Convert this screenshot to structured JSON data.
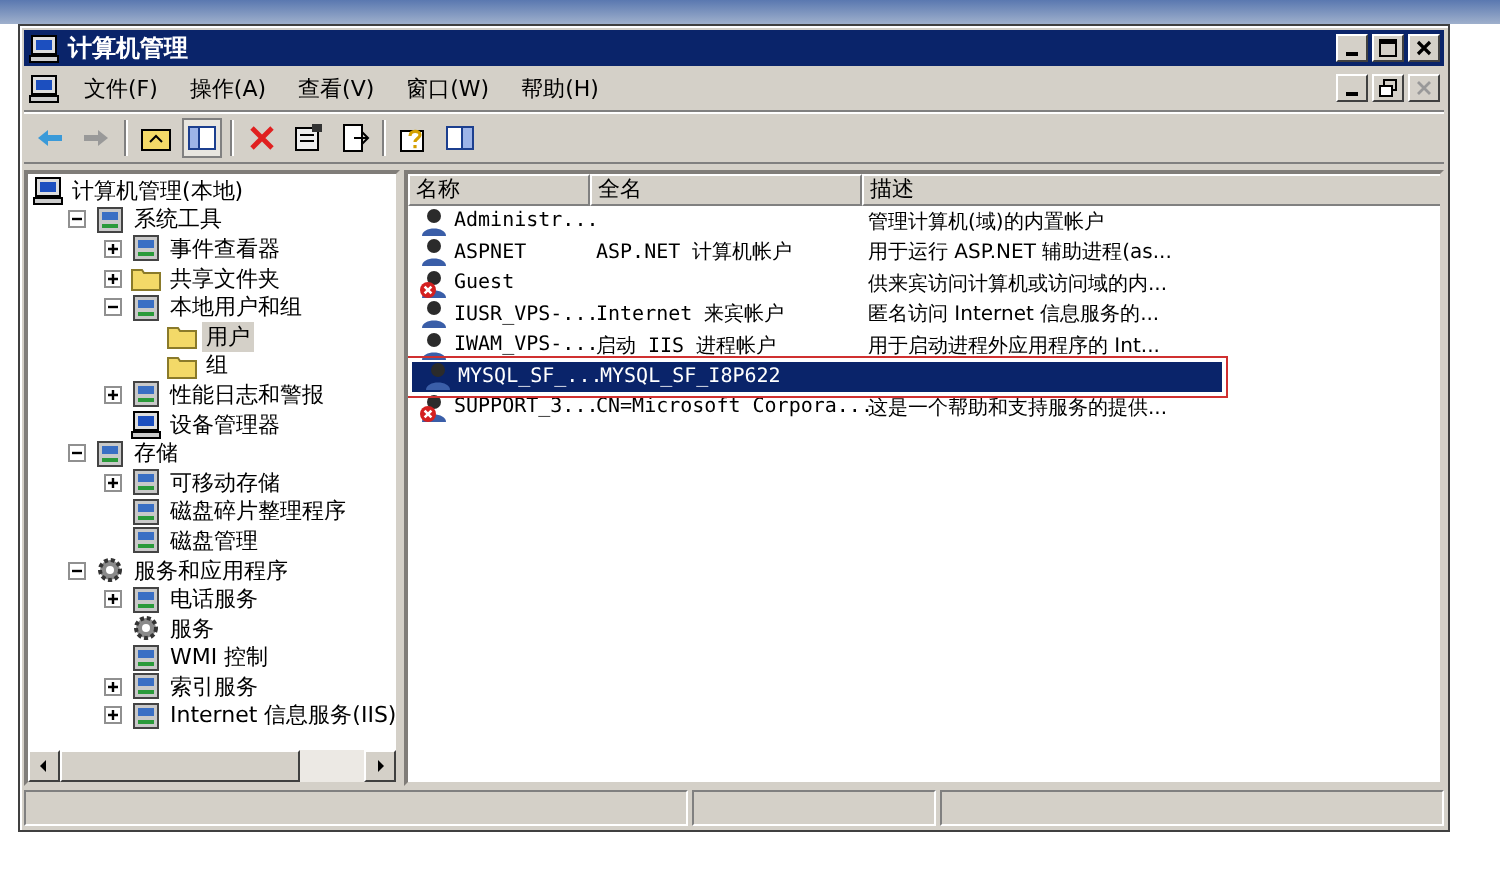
{
  "window": {
    "title": "计算机管理"
  },
  "menu": [
    "文件(F)",
    "操作(A)",
    "查看(V)",
    "窗口(W)",
    "帮助(H)"
  ],
  "tree": {
    "label": "计算机管理(本地)",
    "kind": "computer",
    "selected": false,
    "children": [
      {
        "label": "系统工具",
        "kind": "item",
        "expanded": true,
        "selected": false,
        "children": [
          {
            "label": "事件查看器",
            "kind": "item",
            "expanded": false,
            "selected": false
          },
          {
            "label": "共享文件夹",
            "kind": "folder",
            "expanded": false,
            "selected": false
          },
          {
            "label": "本地用户和组",
            "kind": "item",
            "expanded": true,
            "selected": false,
            "children": [
              {
                "label": "用户",
                "kind": "folder",
                "selected": true
              },
              {
                "label": "组",
                "kind": "folder",
                "selected": false
              }
            ]
          },
          {
            "label": "性能日志和警报",
            "kind": "item",
            "expanded": false,
            "selected": false
          },
          {
            "label": "设备管理器",
            "kind": "computer",
            "selected": false
          }
        ]
      },
      {
        "label": "存储",
        "kind": "item",
        "expanded": true,
        "selected": false,
        "children": [
          {
            "label": "可移动存储",
            "kind": "item",
            "expanded": false,
            "selected": false
          },
          {
            "label": "磁盘碎片整理程序",
            "kind": "item",
            "selected": false
          },
          {
            "label": "磁盘管理",
            "kind": "item",
            "selected": false
          }
        ]
      },
      {
        "label": "服务和应用程序",
        "kind": "gear",
        "expanded": true,
        "selected": false,
        "children": [
          {
            "label": "电话服务",
            "kind": "item",
            "expanded": false,
            "selected": false
          },
          {
            "label": "服务",
            "kind": "gear",
            "selected": false
          },
          {
            "label": "WMI 控制",
            "kind": "item",
            "selected": false
          },
          {
            "label": "索引服务",
            "kind": "item",
            "expanded": false,
            "selected": false
          },
          {
            "label": "Internet 信息服务(IIS)",
            "kind": "item",
            "expanded": false,
            "selected": false
          }
        ]
      }
    ]
  },
  "table": {
    "columns": [
      "名称",
      "全名",
      "描述"
    ],
    "rows": [
      {
        "cells": [
          "Administr...",
          "",
          "管理计算机(域)的内置帐户"
        ],
        "disabled": false,
        "selected": false,
        "outlined": false
      },
      {
        "cells": [
          "ASPNET",
          "ASP.NET 计算机帐户",
          "用于运行 ASP.NET 辅助进程(as..."
        ],
        "disabled": false,
        "selected": false,
        "outlined": false
      },
      {
        "cells": [
          "Guest",
          "",
          "供来宾访问计算机或访问域的内..."
        ],
        "disabled": true,
        "selected": false,
        "outlined": false
      },
      {
        "cells": [
          "IUSR_VPS-...",
          "Internet 来宾帐户",
          "匿名访问 Internet 信息服务的..."
        ],
        "disabled": false,
        "selected": false,
        "outlined": false
      },
      {
        "cells": [
          "IWAM_VPS-...",
          "启动 IIS 进程帐户",
          "用于启动进程外应用程序的 Int..."
        ],
        "disabled": false,
        "selected": false,
        "outlined": false
      },
      {
        "cells": [
          "MYSQL_SF_...",
          "MYSQL_SF_I8P622",
          ""
        ],
        "disabled": false,
        "selected": true,
        "outlined": true
      },
      {
        "cells": [
          "SUPPORT_3...",
          "CN=Microsoft Corpora...",
          "这是一个帮助和支持服务的提供..."
        ],
        "disabled": true,
        "selected": false,
        "outlined": false
      }
    ]
  }
}
